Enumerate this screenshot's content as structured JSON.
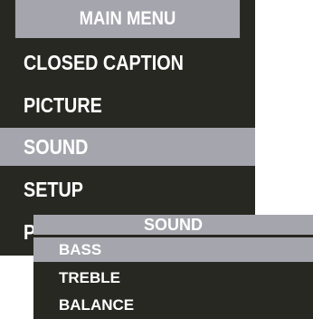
{
  "main_menu": {
    "title": "MAIN MENU",
    "items": [
      {
        "label": "CLOSED CAPTION",
        "selected": false
      },
      {
        "label": "PICTURE",
        "selected": false
      },
      {
        "label": "SOUND",
        "selected": true
      },
      {
        "label": "SETUP",
        "selected": false
      },
      {
        "label": "P",
        "selected": false
      }
    ]
  },
  "sound_menu": {
    "title": "SOUND",
    "items": [
      {
        "label": "BASS",
        "selected": true
      },
      {
        "label": "TREBLE",
        "selected": false
      },
      {
        "label": "BALANCE",
        "selected": false
      }
    ]
  },
  "colors": {
    "panel_background": "#282822",
    "highlight": "#a5a5ad",
    "text": "#ffffff"
  }
}
